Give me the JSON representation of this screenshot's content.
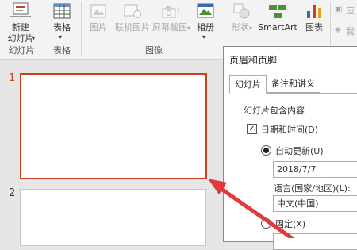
{
  "ribbon": {
    "buttons": {
      "new_slide": "新建\n幻灯片",
      "table": "表格",
      "pictures": "图片",
      "online_pictures": "联机图片",
      "screenshot": "屏幕截图",
      "album": "相册",
      "shapes": "形状",
      "smartart": "SmartArt",
      "chart": "图表",
      "partial_right": "应",
      "partial_right2": "我"
    },
    "groups": {
      "slides": "幻灯片",
      "tables": "表格",
      "images": "图像"
    }
  },
  "thumbnails": {
    "numbers": [
      "1",
      "2"
    ]
  },
  "dialog": {
    "title": "页眉和页脚",
    "tabs": [
      "幻灯片",
      "备注和讲义"
    ],
    "section_title": "幻灯片包含内容",
    "date_time_label": "日期和时间(D)",
    "date_time_checked": true,
    "auto_update_label": "自动更新(U)",
    "auto_update_selected": true,
    "date_value": "2018/7/7",
    "language_label": "语言(国家/地区)(L):",
    "language_value": "中文(中国)",
    "fixed_label": "固定(X)"
  },
  "colors": {
    "selection_border": "#c8421c",
    "arrow": "#e03a3a"
  }
}
